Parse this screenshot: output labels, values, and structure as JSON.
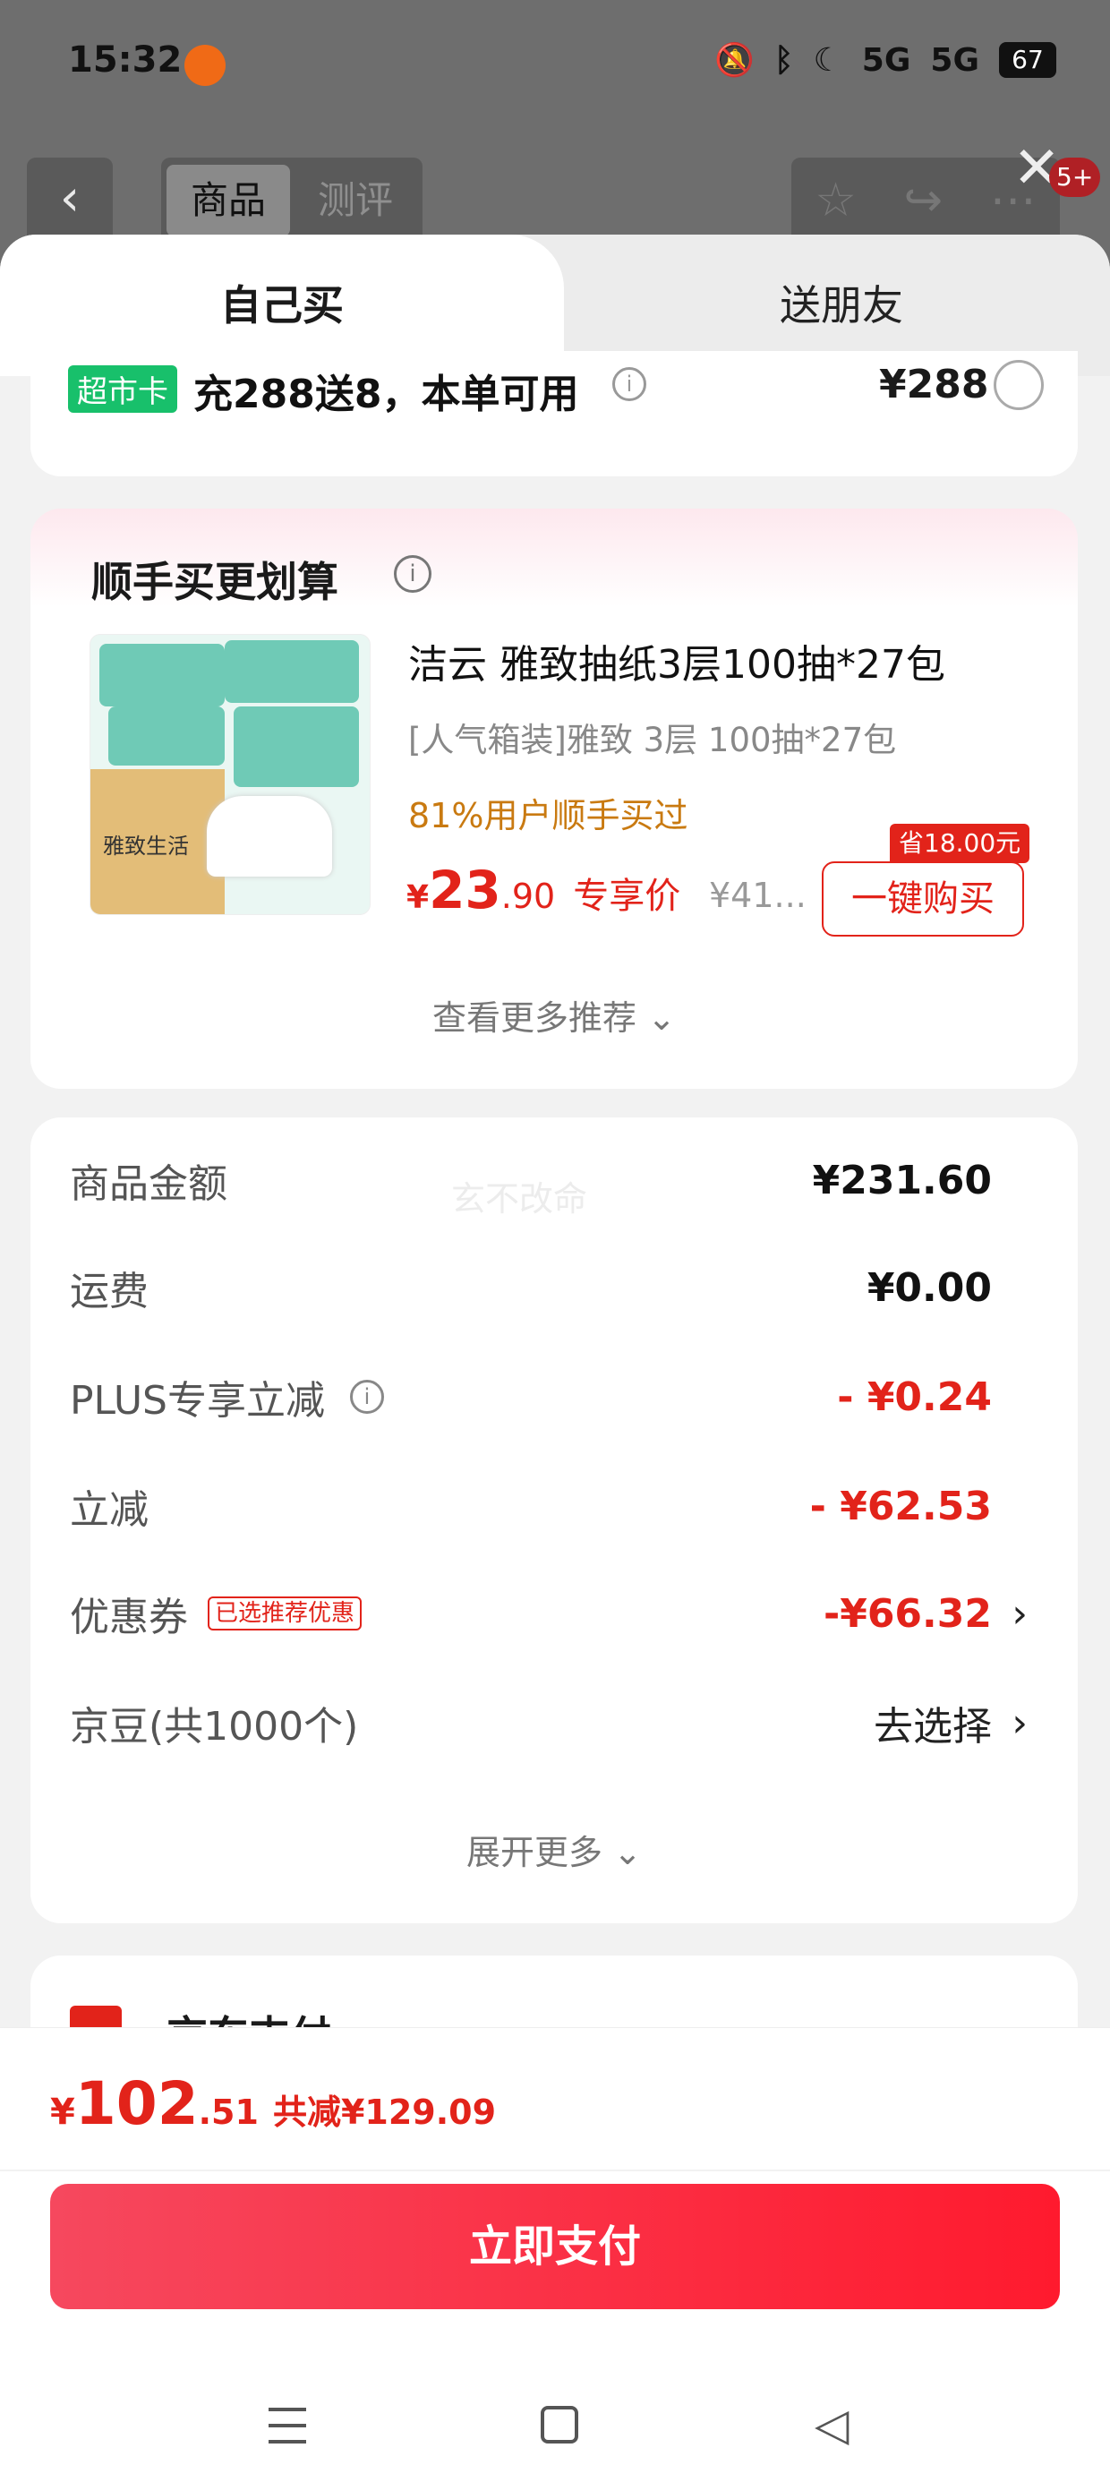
{
  "status_bar": {
    "time": "15:32",
    "icons": [
      "mute-icon",
      "bluetooth-icon",
      "moon-icon",
      "5g-signal-icon",
      "5g-signal-icon"
    ],
    "network_1": "5G",
    "network_2": "5G",
    "battery": "67"
  },
  "top_nav": {
    "back_icon": "chevron-left-icon",
    "tabs": [
      "商品",
      "测评"
    ],
    "right_icons": [
      "star-icon",
      "share-icon",
      "more-icon"
    ],
    "badge": "5+"
  },
  "sheet": {
    "tabs": [
      "自己买",
      "送朋友"
    ],
    "supermarket_card": {
      "tag": "超市卡",
      "text": "充288送8，本单可用",
      "price": "¥288"
    },
    "recommend": {
      "title": "顺手买更划算",
      "product_name": "洁云 雅致抽纸3层100抽*27包",
      "product_sub": "[人气箱装]雅致 3层 100抽*27包",
      "hint": "81%用户顺手买过",
      "price_symbol": "¥",
      "price_int": "23",
      "price_dec": ".90",
      "price_label": "专享价",
      "orig_price": "¥41...",
      "save_badge": "省18.00元",
      "buy_button": "一键购买",
      "image_box_text": "雅致生活",
      "more": "查看更多推荐 ⌄"
    },
    "summary": {
      "watermark": "玄不改命",
      "rows": [
        {
          "label": "商品金额",
          "value": "¥231.60"
        },
        {
          "label": "运费",
          "value": "¥0.00"
        },
        {
          "label": "PLUS专享立减",
          "value": "- ¥0.24"
        },
        {
          "label": "立减",
          "value": "- ¥62.53"
        },
        {
          "label": "优惠券",
          "chip": "已选推荐优惠",
          "value": "-¥66.32"
        },
        {
          "label": "京豆(共1000个)",
          "value": "去选择"
        }
      ],
      "arrow": "›",
      "more": "展开更多 ⌄"
    },
    "payment": {
      "label": "京东支付"
    }
  },
  "bottom_bar": {
    "total_symbol": "¥",
    "total_int": "102",
    "total_dec": ".51",
    "saved": "共减¥129.09",
    "pay_button": "立即支付"
  },
  "colors": {
    "accent_red": "#e2231a",
    "green_tag": "#18c06b",
    "hint_orange": "#c97a11"
  }
}
